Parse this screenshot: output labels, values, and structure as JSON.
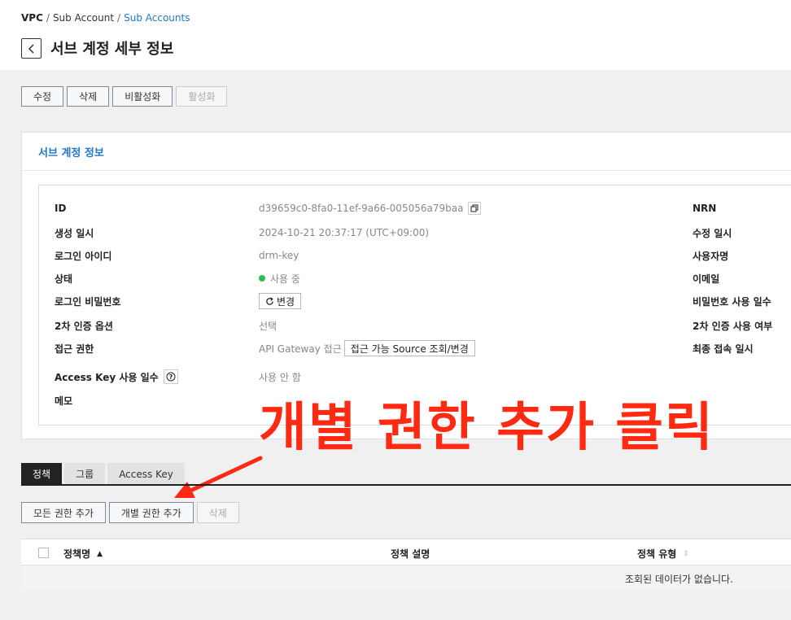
{
  "breadcrumb": {
    "root": "VPC",
    "sep1": "/",
    "middle": "Sub Account",
    "sep2": "/",
    "current": "Sub Accounts"
  },
  "header": {
    "title": "서브 계정 세부 정보"
  },
  "toolbar": {
    "edit": "수정",
    "delete": "삭제",
    "deactivate": "비활성화",
    "activate": "활성화"
  },
  "panel": {
    "title": "서브 계정 정보",
    "fields": {
      "id_label": "ID",
      "id_value": "d39659c0-8fa0-11ef-9a66-005056a79baa",
      "created_label": "생성 일시",
      "created_value": "2024-10-21 20:37:17 (UTC+09:00)",
      "login_id_label": "로그인 아이디",
      "login_id_value": "drm-key",
      "status_label": "상태",
      "status_value": "사용 중",
      "password_label": "로그인 비밀번호",
      "password_button": "변경",
      "mfa_label": "2차 인증 옵션",
      "mfa_value": "선택",
      "access_label": "접근 권한",
      "access_value": "API Gateway 접근",
      "access_button": "접근 가능 Source 조회/변경",
      "access_key_days_label": "Access Key 사용 일수",
      "access_key_days_value": "사용 안 함",
      "memo_label": "메모"
    },
    "right_fields": {
      "nrn": "NRN",
      "modified": "수정 일시",
      "username": "사용자명",
      "email": "이메일",
      "password_days": "비밀번호 사용 일수",
      "mfa_enabled": "2차 인증 사용 여부",
      "last_login": "최종 접속 일시"
    }
  },
  "annotation": {
    "text": "개별 권한 추가 클릭",
    "color": "#ff2a12"
  },
  "tabs": [
    {
      "label": "정책"
    },
    {
      "label": "그룹"
    },
    {
      "label": "Access Key"
    }
  ],
  "actions": {
    "add_all": "모든 권한 추가",
    "add_individual": "개별 권한 추가",
    "delete": "삭제"
  },
  "table": {
    "columns": [
      "정책명",
      "정책 설명",
      "정책 유형"
    ],
    "empty_message": "조회된 데이터가 없습니다."
  },
  "colors": {
    "accent": "#1f78c8",
    "status_active": "#2fbf4f"
  }
}
